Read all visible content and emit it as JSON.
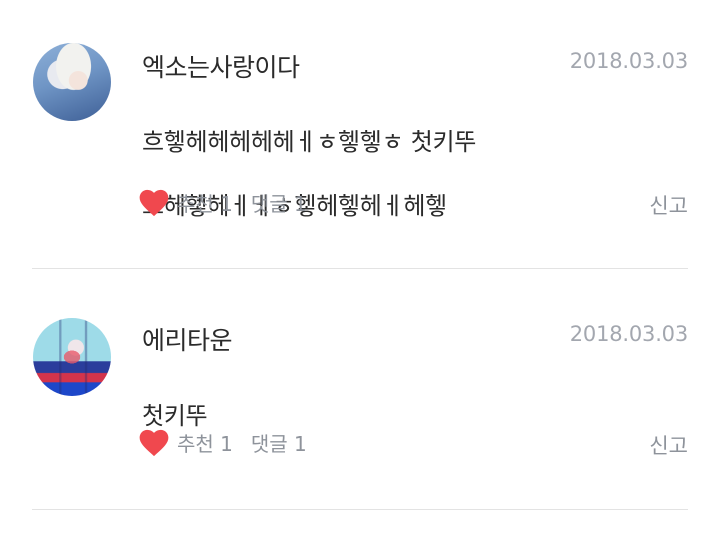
{
  "comments": [
    {
      "username": "엑소는사랑이다",
      "date": "2018.03.03",
      "text_line1": "흐헿헤헤헤헤헤ㅔㅎ헿헿ㅎ 첫키뚜",
      "text_line2": "으헤헿헤ㅔㅔㅎ헿헤헿헤ㅔ헤헿",
      "like_label": "추천 1",
      "reply_label": "댓글 1",
      "report_label": "신고"
    },
    {
      "username": "에리타운",
      "date": "2018.03.03",
      "text_line1": "첫키뚜",
      "like_label": "추천 1",
      "reply_label": "댓글 1",
      "report_label": "신고"
    }
  ],
  "colors": {
    "heart": "#f0484e",
    "meta_text": "#8e939b",
    "date_text": "#a3a7af",
    "divider": "#e3e3e3"
  }
}
